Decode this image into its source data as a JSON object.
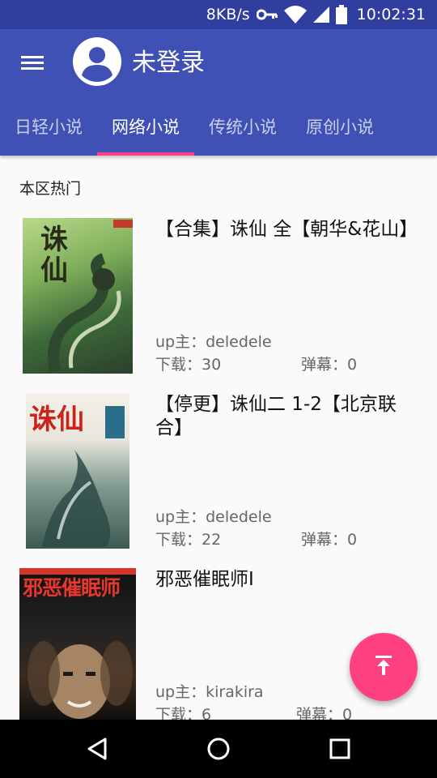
{
  "status_bar": {
    "net_speed": "8KB/s",
    "time": "10:02:31",
    "icons": [
      "vpn-key-icon",
      "wifi-icon",
      "cell-signal-icon",
      "battery-icon"
    ]
  },
  "app_bar": {
    "menu_icon": "menu-icon",
    "avatar_icon": "account-circle-icon",
    "user_name": "未登录"
  },
  "tabs": [
    {
      "label": "日轻小说",
      "active": false
    },
    {
      "label": "网络小说",
      "active": true
    },
    {
      "label": "传统小说",
      "active": false
    },
    {
      "label": "原创小说",
      "active": false
    }
  ],
  "section_title": "本区热门",
  "books": [
    {
      "title": "【合集】诛仙 全【朝华&花山】",
      "uploader": "up主：deledele",
      "downloads": "下载：30",
      "danmaku": "弹幕：0",
      "cover_text": "诛仙"
    },
    {
      "title": "【停更】诛仙二 1-2【北京联合】",
      "uploader": "up主：deledele",
      "downloads": "下载：22",
      "danmaku": "弹幕：0",
      "cover_text": "诛仙"
    },
    {
      "title": "邪恶催眠师I",
      "uploader": "up主：kirakira",
      "downloads": "下载：6",
      "danmaku": "弹幕：0",
      "cover_text": "邪恶催眠师"
    }
  ],
  "fab": {
    "icon": "vertical-align-top-icon"
  },
  "nav_bar": {
    "icons": [
      "back-icon",
      "home-icon",
      "recents-icon"
    ]
  },
  "colors": {
    "primary": "#3f51b5",
    "primary_dark": "#303f9f",
    "accent": "#ff4081"
  }
}
